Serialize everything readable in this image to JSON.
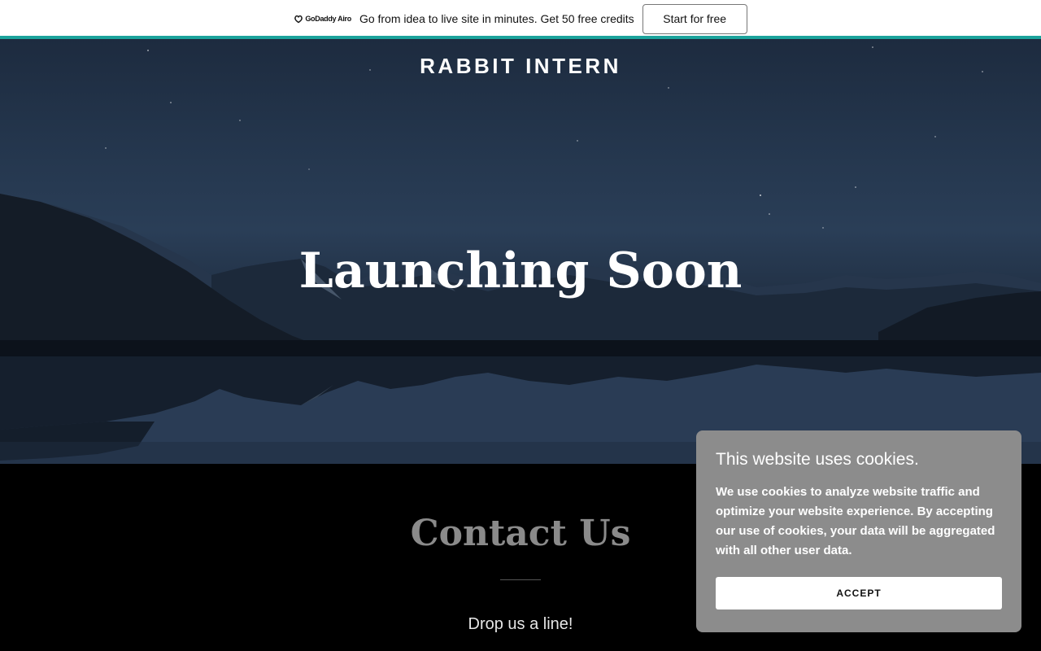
{
  "promo": {
    "logo_text": "GoDaddy Airo",
    "message": "Go from idea to live site in minutes. Get 50 free credits",
    "cta_label": "Start for free"
  },
  "hero": {
    "brand": "RABBIT INTERN",
    "title": "Launching Soon"
  },
  "contact": {
    "title": "Contact Us",
    "subtitle": "Drop us a line!"
  },
  "cookie": {
    "title": "This website uses cookies.",
    "body": "We use cookies to analyze website traffic and optimize your website experience. By accepting our use of cookies, your data will be aggregated with all other user data.",
    "accept_label": "ACCEPT"
  },
  "colors": {
    "accent": "#1ba39c",
    "cookie_bg": "#8c8c8c",
    "page_bg": "#000000"
  }
}
